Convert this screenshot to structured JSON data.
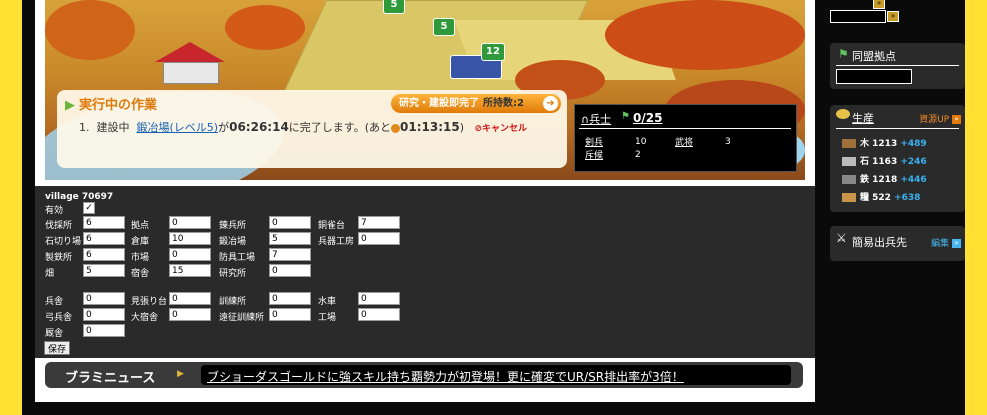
{
  "map": {
    "markers": [
      "5",
      "5",
      "12"
    ]
  },
  "work": {
    "title": "実行中の作業",
    "finish_button": "研究・建設即完了",
    "holdings_label": "所持数:2",
    "row_index": "1.",
    "row_status": "建設中",
    "row_target": "鍛冶場(レベル5)",
    "row_connector": "が",
    "row_time": "06:26:14",
    "row_suffix": "に完了します。(あと",
    "row_remaining": "01:13:15",
    "row_close": ")",
    "cancel": "キャンセル"
  },
  "soldiers": {
    "label": "兵士",
    "count": "0/25",
    "rows": [
      {
        "name1": "剣兵",
        "val1": "10",
        "name2": "武将",
        "val2": "3"
      },
      {
        "name1": "斥候",
        "val1": "2",
        "name2": "",
        "val2": ""
      }
    ]
  },
  "form": {
    "village_label": "village 70697",
    "enabled_label": "有効",
    "enabled_check": "✓",
    "group1": [
      {
        "label": "伐採所",
        "value": "6"
      },
      {
        "label": "石切り場",
        "value": "6"
      },
      {
        "label": "製鉄所",
        "value": "6"
      },
      {
        "label": "畑",
        "value": "5"
      },
      {
        "label": "拠点",
        "value": "0"
      },
      {
        "label": "倉庫",
        "value": "10"
      },
      {
        "label": "市場",
        "value": "0"
      },
      {
        "label": "宿舎",
        "value": "15"
      },
      {
        "label": "錬兵所",
        "value": "0"
      },
      {
        "label": "鍛冶場",
        "value": "5"
      },
      {
        "label": "防具工場",
        "value": "7"
      },
      {
        "label": "研究所",
        "value": "0"
      },
      {
        "label": "銅雀台",
        "value": "7"
      },
      {
        "label": "兵器工房",
        "value": "0"
      }
    ],
    "group2": [
      {
        "label": "兵舎",
        "value": "0"
      },
      {
        "label": "弓兵舎",
        "value": "0"
      },
      {
        "label": "厩舎",
        "value": "0"
      },
      {
        "label": "見張り台",
        "value": "0"
      },
      {
        "label": "大宿舎",
        "value": "0"
      },
      {
        "label": "訓練所",
        "value": "0"
      },
      {
        "label": "遠征訓練所",
        "value": "0"
      },
      {
        "label": "水車",
        "value": "0"
      },
      {
        "label": "工場",
        "value": "0"
      }
    ],
    "save_label": "保存"
  },
  "news": {
    "title": "ブラミニュース",
    "headline": "ブショーダスゴールドに強スキル持ち覇勢力が初登場！更に確変でUR/SR排出率が3倍！"
  },
  "sidebar": {
    "top_button": "»",
    "alliance_title": "同盟拠点",
    "production_title": "生産",
    "production_link": "資源UP",
    "resources": [
      {
        "name": "木",
        "amount": "1213",
        "plus": "+489"
      },
      {
        "name": "石",
        "amount": "1163",
        "plus": "+246"
      },
      {
        "name": "鉄",
        "amount": "1218",
        "plus": "+446"
      },
      {
        "name": "糧",
        "amount": "522",
        "plus": "+638"
      }
    ],
    "dispatch_title": "簡易出兵先",
    "dispatch_link": "編集"
  },
  "colors": {
    "page_bg": "#ffe033",
    "accent_orange": "#e07a0a",
    "link_blue": "#4ab8f0",
    "plus_blue": "#3ab0f0"
  }
}
